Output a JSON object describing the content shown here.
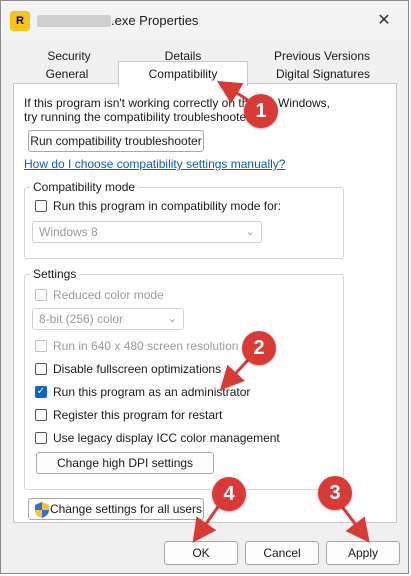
{
  "window": {
    "title": ".exe Properties",
    "close_glyph": "✕",
    "app_icon_letter": "R"
  },
  "tabs": {
    "row1": [
      "Security",
      "Details",
      "Previous Versions"
    ],
    "row2": [
      "General",
      "Compatibility",
      "Digital Signatures"
    ],
    "active": "Compatibility"
  },
  "panel": {
    "intro_line1": "If this program isn't working correctly on this ve",
    "intro_line1_end": "Windows,",
    "intro_line2": "try running the compatibility troubleshooter.",
    "troubleshooter_button": "Run compatibility troubleshooter",
    "manual_link": "How do I choose compatibility settings manually?",
    "compat_mode": {
      "label": "Compatibility mode",
      "checkbox": "Run this program in compatibility mode for:",
      "select_value": "Windows 8"
    },
    "settings": {
      "label": "Settings",
      "reduced_color": "Reduced color mode",
      "color_select": "8-bit (256) color",
      "run_640": "Run in 640 x 480 screen resolution",
      "disable_fullscreen": "Disable fullscreen optimizations",
      "run_as_admin": "Run this program as an administrator",
      "register_restart": "Register this program for restart",
      "legacy_icc": "Use legacy display ICC color management",
      "dpi_button": "Change high DPI settings",
      "run_as_admin_checked": true
    },
    "all_users_button": "Change settings for all users"
  },
  "footer": {
    "ok": "OK",
    "cancel": "Cancel",
    "apply": "Apply"
  },
  "annotations": [
    "1",
    "2",
    "3",
    "4"
  ],
  "colors": {
    "badge": "#d93a35",
    "accent": "#0a64c8",
    "link": "#0a5dbb"
  }
}
